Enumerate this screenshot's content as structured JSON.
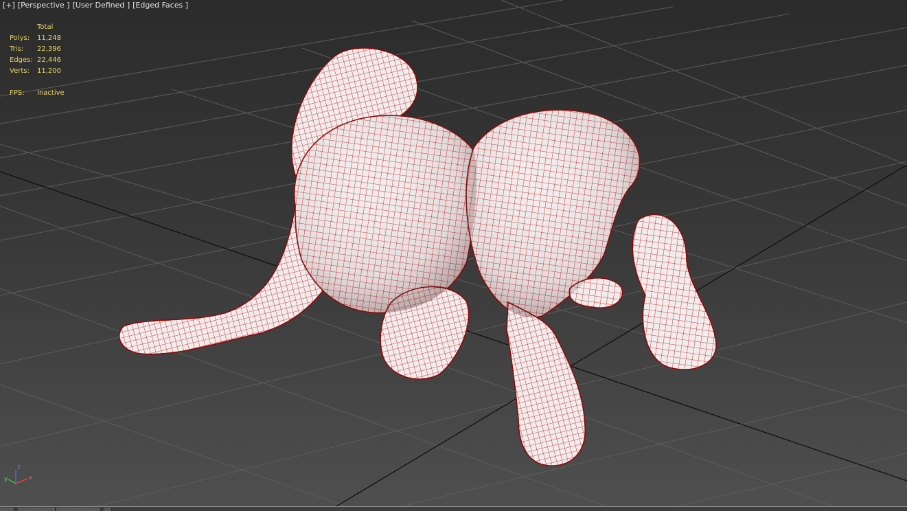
{
  "viewport": {
    "labels": [
      "[+]",
      "[Perspective ]",
      "[User Defined ]",
      "[Edged Faces ]"
    ]
  },
  "stats": {
    "header": "Total",
    "rows": [
      {
        "label": "Polys:",
        "value": "11,248"
      },
      {
        "label": "Tris:",
        "value": "22,396"
      },
      {
        "label": "Edges:",
        "value": "22,446"
      },
      {
        "label": "Verts:",
        "value": "11,200"
      }
    ],
    "fps_label": "FPS:",
    "fps_value": "Inactive"
  },
  "axis_gizmo": {
    "x": "x",
    "y": "y",
    "z": "z"
  },
  "colors": {
    "stats_text": "#e8d36a",
    "wire": "#b01010",
    "mesh_fill": "#f3eded",
    "grid": "#5a5a5a",
    "grid_main": "#0a0a0a"
  }
}
